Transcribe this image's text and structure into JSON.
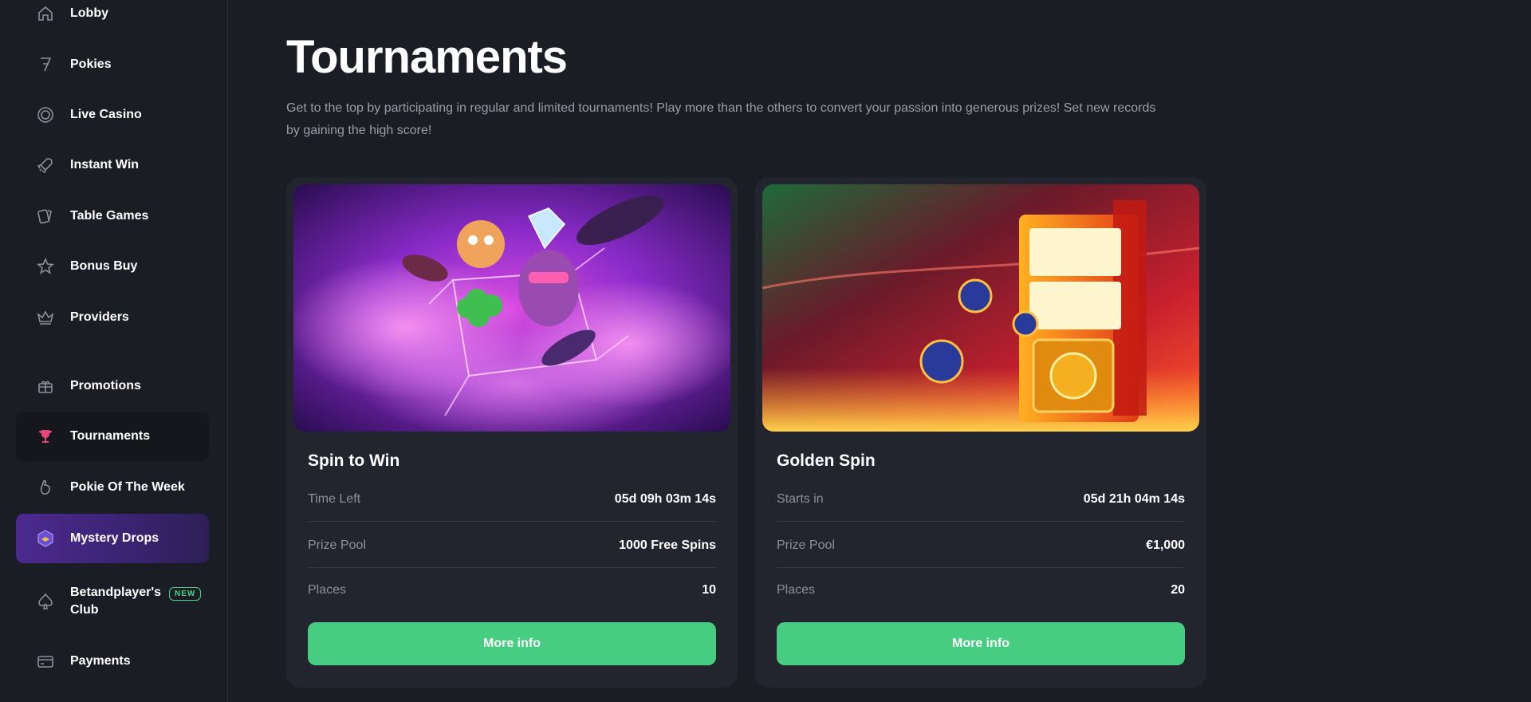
{
  "sidebar": {
    "items": [
      {
        "label": "Lobby",
        "icon": "home-icon"
      },
      {
        "label": "Pokies",
        "icon": "seven-icon"
      },
      {
        "label": "Live Casino",
        "icon": "chip-icon"
      },
      {
        "label": "Instant Win",
        "icon": "rocket-icon"
      },
      {
        "label": "Table Games",
        "icon": "cards-icon"
      },
      {
        "label": "Bonus Buy",
        "icon": "star-icon"
      },
      {
        "label": "Providers",
        "icon": "crown-icon"
      },
      {
        "label": "Promotions",
        "icon": "gift-icon"
      },
      {
        "label": "Tournaments",
        "icon": "trophy-icon"
      },
      {
        "label": "Pokie Of The Week",
        "icon": "hand-icon"
      },
      {
        "label": "Mystery Drops",
        "icon": "mystery-box-icon"
      },
      {
        "label": "Betandplayer's Club",
        "icon": "spade-icon",
        "badge": "NEW"
      },
      {
        "label": "Payments",
        "icon": "card-icon"
      }
    ],
    "active": "Tournaments"
  },
  "main": {
    "title": "Tournaments",
    "description": "Get to the top by participating in regular and limited tournaments! Play more than the others to convert your passion into generous prizes! Set new records by gaining the high score!",
    "cards": [
      {
        "title": "Spin to Win",
        "image": "spin-to-win-banner",
        "rows": [
          {
            "label": "Time Left",
            "value": "05d 09h 03m 14s"
          },
          {
            "label": "Prize Pool",
            "value": "1000 Free Spins"
          },
          {
            "label": "Places",
            "value": "10"
          }
        ],
        "button": "More info"
      },
      {
        "title": "Golden Spin",
        "image": "golden-spin-banner",
        "rows": [
          {
            "label": "Starts in",
            "value": "05d 21h 04m 14s"
          },
          {
            "label": "Prize Pool",
            "value": "€1,000"
          },
          {
            "label": "Places",
            "value": "20"
          }
        ],
        "button": "More info"
      }
    ]
  },
  "colors": {
    "background": "#1b1d24",
    "card": "#22252e",
    "accent_green": "#46cd82",
    "active_icon": "#e8457a",
    "mystery_purple": "#4c2a8f"
  }
}
